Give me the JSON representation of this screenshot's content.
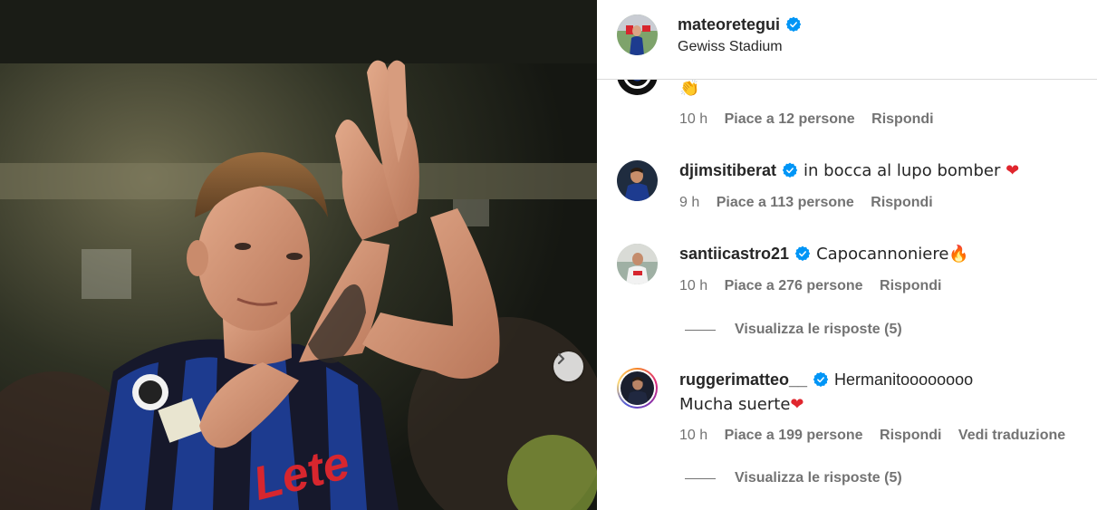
{
  "post": {
    "author": "mateoretegui",
    "location": "Gewiss Stadium",
    "verified": true
  },
  "comments": [
    {
      "username": "",
      "verified": false,
      "text": "👏",
      "time": "10 h",
      "likes": "Piace a 12 persone",
      "reply": "Rispondi"
    },
    {
      "username": "djimsitiberat",
      "verified": true,
      "text": "in bocca al lupo bomber ❤️",
      "time": "9 h",
      "likes": "Piace a 113 persone",
      "reply": "Rispondi"
    },
    {
      "username": "santiicastro21",
      "verified": true,
      "text": "Capocannoniere🔥",
      "time": "10 h",
      "likes": "Piace a 276 persone",
      "reply": "Rispondi",
      "view_replies": "Visualizza le risposte (5)"
    },
    {
      "username": "ruggerimatteo__",
      "verified": true,
      "text": "Hermanitoooooooo",
      "text_line2": "Mucha suerte❤️",
      "time": "10 h",
      "likes": "Piace a 199 persone",
      "reply": "Rispondi",
      "translate": "Vedi traduzione",
      "view_replies": "Visualizza le risposte (5)"
    }
  ],
  "icons": {
    "verified": "verified-badge-icon",
    "next": "chevron-right-icon"
  },
  "colors": {
    "verified_blue": "#0095f6",
    "meta_grey": "#737373",
    "jersey_blue": "#1d3b8f",
    "jersey_black": "#111111",
    "sponsor_red": "#d7262e"
  }
}
